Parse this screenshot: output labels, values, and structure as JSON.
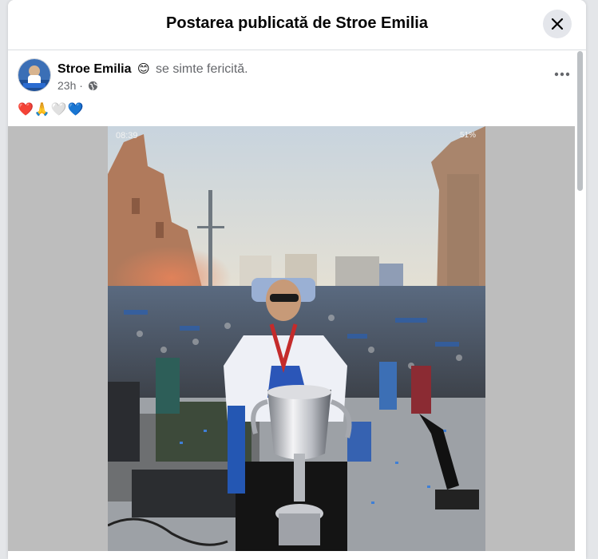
{
  "dialog": {
    "title": "Postarea publicată de Stroe Emilia",
    "close_icon": "close-icon"
  },
  "post": {
    "author": "Stroe Emilia",
    "feeling_emoji": "😊",
    "feeling_text": "se simte fericită.",
    "time": "23h",
    "separator": "·",
    "privacy_icon": "globe-icon",
    "more_icon": "more-horizontal-icon",
    "text": "❤️🙏🤍💙"
  },
  "photo": {
    "status_time": "08:39",
    "status_battery": "51%",
    "description_icon": "photo-image"
  },
  "colors": {
    "background": "#e4e6e9",
    "header_border": "#dadde1",
    "close_bg": "#e4e6eb",
    "photo_letterbox": "#bdbdbd"
  }
}
